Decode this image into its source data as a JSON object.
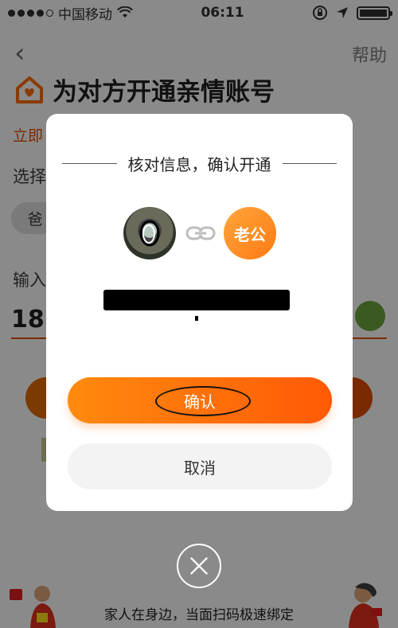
{
  "status_bar": {
    "carrier": "中国移动",
    "time": "06:11"
  },
  "nav": {
    "help_label": "帮助"
  },
  "page": {
    "title": "为对方开通亲情账号",
    "link_text": "立即",
    "select_label": "选择",
    "chip_label": "爸",
    "input_label": "输入",
    "phone_partial": "18"
  },
  "modal": {
    "title": "核对信息，确认开通",
    "other_name": "老公",
    "phone_redacted": "",
    "confirm_label": "确认",
    "cancel_label": "取消"
  },
  "footer": {
    "caption": "家人在身边，当面扫码极速绑定"
  },
  "colors": {
    "accent": "#ff7a14",
    "accent_dark": "#ff5a05"
  }
}
